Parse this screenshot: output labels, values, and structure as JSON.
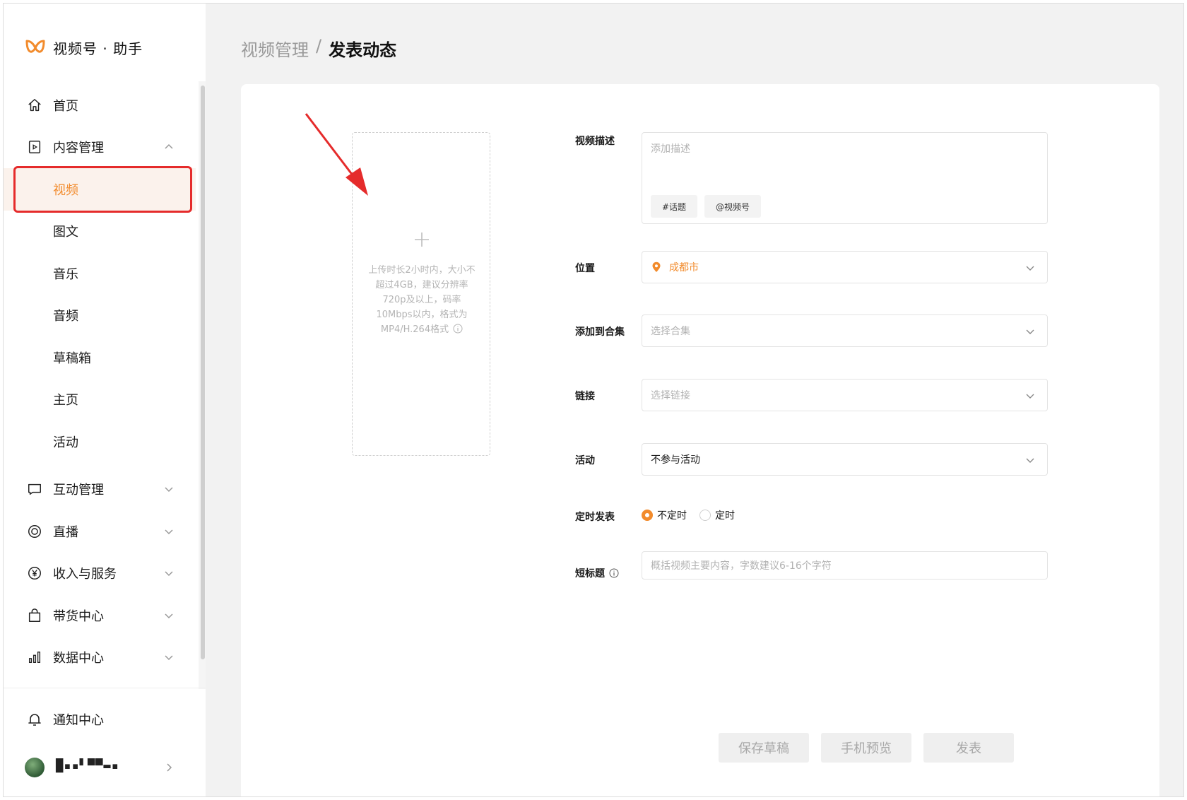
{
  "brand": {
    "name": "视频号 · 助手",
    "accent": "#f28b2c"
  },
  "sidebar": {
    "items": [
      {
        "label": "首页",
        "icon": "home-icon"
      },
      {
        "label": "内容管理",
        "icon": "play-box-icon",
        "expanded": true
      },
      {
        "label": "视频",
        "active": true
      },
      {
        "label": "图文"
      },
      {
        "label": "音乐"
      },
      {
        "label": "音频"
      },
      {
        "label": "草稿箱"
      },
      {
        "label": "主页"
      },
      {
        "label": "活动"
      },
      {
        "label": "互动管理",
        "icon": "chat-icon"
      },
      {
        "label": "直播",
        "icon": "live-icon"
      },
      {
        "label": "收入与服务",
        "icon": "yen-icon"
      },
      {
        "label": "带货中心",
        "icon": "shopping-bag-icon"
      },
      {
        "label": "数据中心",
        "icon": "bar-chart-icon"
      }
    ],
    "notify": "通知中心",
    "user_name": "█▪▪▘▀▀▬▪"
  },
  "breadcrumb": {
    "parent": "视频管理",
    "separator": "/",
    "current": "发表动态"
  },
  "upload": {
    "tip": "上传时长2小时内，大小不超过4GB，建议分辨率720p及以上，码率10Mbps以内，格式为MP4/H.264格式"
  },
  "form": {
    "description_label": "视频描述",
    "description_placeholder": "添加描述",
    "topic_button": "#话题",
    "mention_button": "@视频号",
    "location_label": "位置",
    "location_value": "成都市",
    "collection_label": "添加到合集",
    "collection_placeholder": "选择合集",
    "link_label": "链接",
    "link_placeholder": "选择链接",
    "activity_label": "活动",
    "activity_value": "不参与活动",
    "schedule_label": "定时发表",
    "schedule_options": [
      "不定时",
      "定时"
    ],
    "schedule_selected": "不定时",
    "short_title_label": "短标题",
    "short_title_placeholder": "概括视频主要内容，字数建议6-16个字符"
  },
  "actions": {
    "save_draft": "保存草稿",
    "phone_preview": "手机预览",
    "publish": "发表"
  }
}
